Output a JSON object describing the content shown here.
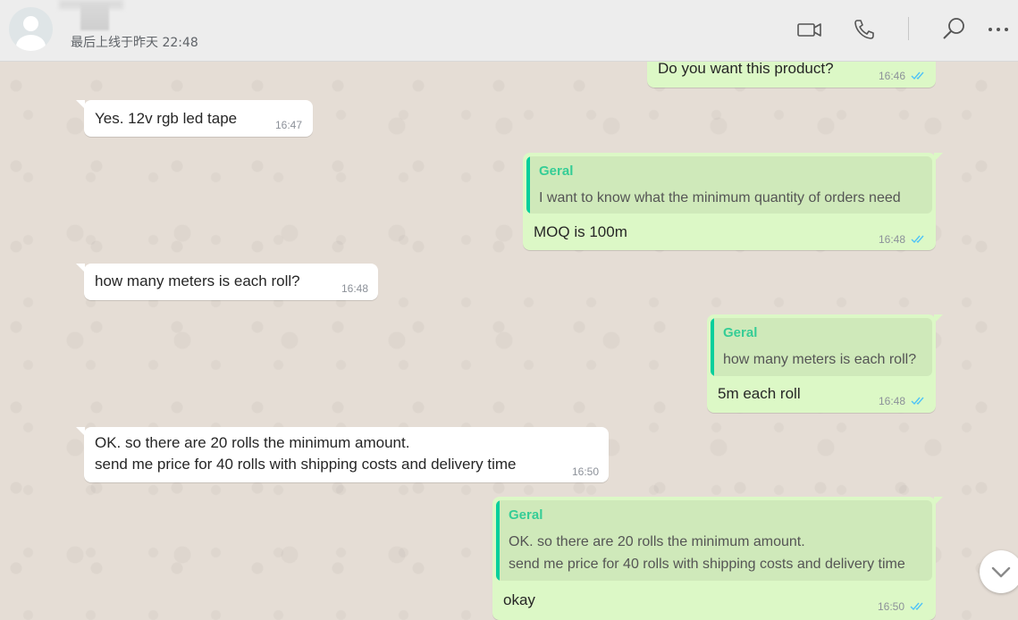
{
  "header": {
    "last_seen": "最后上线于昨天 22:48",
    "icons": [
      "video-call-icon",
      "voice-call-icon",
      "search-icon",
      "menu-icon"
    ]
  },
  "messages": [
    {
      "direction": "out",
      "text": "Do you want this product?",
      "time": "16:46",
      "status": "read"
    },
    {
      "direction": "in",
      "text": "Yes. 12v rgb led tape",
      "time": "16:47"
    },
    {
      "direction": "out",
      "quote": {
        "name": "Geral",
        "text": "I want to know what the minimum quantity of orders need"
      },
      "text": "MOQ is 100m",
      "time": "16:48",
      "status": "read"
    },
    {
      "direction": "in",
      "text": "how many meters is each roll?",
      "time": "16:48"
    },
    {
      "direction": "out",
      "quote": {
        "name": "Geral",
        "text": "how many meters is each roll?"
      },
      "text": "5m each roll",
      "time": "16:48",
      "status": "read"
    },
    {
      "direction": "in",
      "text": "OK. so there are 20 rolls the minimum amount.\nsend me price for 40 rolls with shipping costs and delivery time",
      "time": "16:50"
    },
    {
      "direction": "out",
      "quote": {
        "name": "Geral",
        "text": "OK. so there are 20 rolls the minimum amount.\nsend me price for 40 rolls with shipping costs and delivery time"
      },
      "text": "okay",
      "time": "16:50",
      "status": "read"
    }
  ],
  "colors": {
    "outgoing": "#dcf8c6",
    "incoming": "#ffffff",
    "quote_name": "#35cd96",
    "read_ticks": "#4fc3f7"
  }
}
